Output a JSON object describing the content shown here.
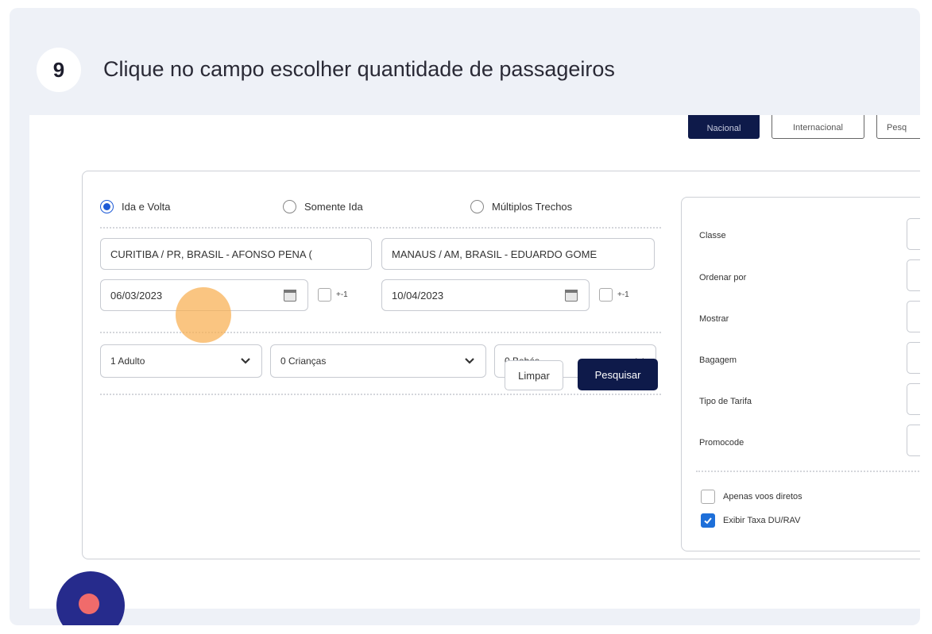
{
  "step": {
    "number": "9",
    "title": "Clique no campo escolher quantidade de passageiros"
  },
  "top_tabs": {
    "nacional": "Nacional",
    "internacional": "Internacional",
    "pesquisa": "Pesq"
  },
  "trip_type": {
    "options": [
      "Ida e Volta",
      "Somente Ida",
      "Múltiplos Trechos"
    ],
    "selected": "Ida e Volta"
  },
  "route": {
    "origin": "CURITIBA / PR, BRASIL - AFONSO PENA (",
    "destination": "MANAUS / AM, BRASIL - EDUARDO GOME"
  },
  "dates": {
    "departure": "06/03/2023",
    "return": "10/04/2023",
    "flex_label": "+-1"
  },
  "passengers": {
    "adults": "1 Adulto",
    "children": "0 Crianças",
    "infants": "0 Bebés"
  },
  "actions": {
    "clear": "Limpar",
    "search": "Pesquisar"
  },
  "filters": {
    "labels": [
      "Classe",
      "Ordenar por",
      "Mostrar",
      "Bagagem",
      "Tipo de Tarifa",
      "Promocode"
    ],
    "direct_only": "Apenas voos diretos",
    "show_fee": "Exibir Taxa DU/RAV",
    "direct_only_checked": false,
    "show_fee_checked": true
  },
  "colors": {
    "primary_navy": "#0e1a4a",
    "accent_blue": "#1e5bd6",
    "click_marker": "#f8af50"
  }
}
